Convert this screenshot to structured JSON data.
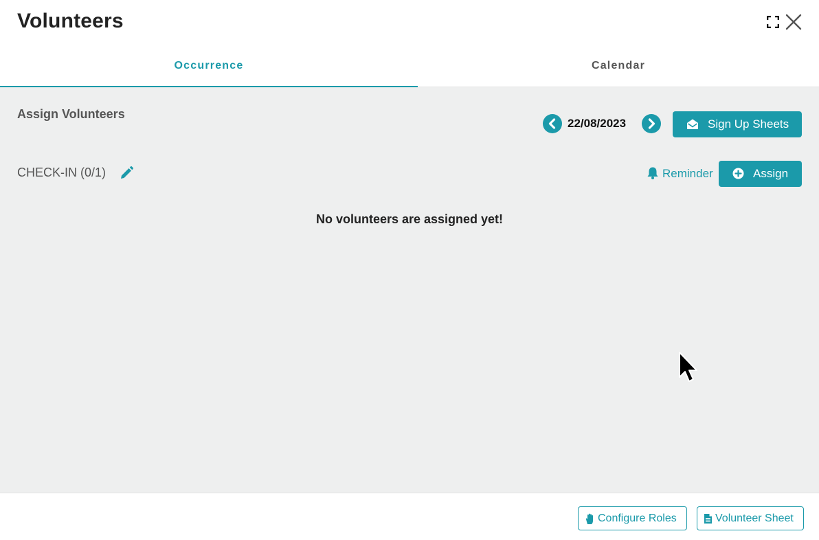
{
  "header": {
    "title": "Volunteers"
  },
  "tabs": [
    {
      "label": "Occurrence",
      "active": true
    },
    {
      "label": "Calendar",
      "active": false
    }
  ],
  "main": {
    "section_title": "Assign Volunteers",
    "date": "22/08/2023",
    "signup_label": "Sign Up Sheets",
    "role": {
      "label": "CHECK-IN (0/1)"
    },
    "reminder_label": "Reminder",
    "assign_label": "Assign",
    "empty_message": "No volunteers are assigned yet!"
  },
  "footer": {
    "configure_roles_label": "Configure Roles",
    "volunteer_sheet_label": "Volunteer Sheet"
  },
  "icons": {
    "expand": "expand-icon",
    "close": "close-icon",
    "prev": "chevron-left-circle-icon",
    "next": "chevron-right-circle-icon",
    "signup": "envelope-open-icon",
    "edit": "pencil-icon",
    "reminder": "bell-icon",
    "assign": "plus-circle-icon",
    "configure": "hand-icon",
    "sheet": "file-icon"
  },
  "colors": {
    "accent": "#1b9aaa",
    "panel_background": "#eeefef",
    "text_dark": "#222222",
    "text_muted": "#555555"
  }
}
